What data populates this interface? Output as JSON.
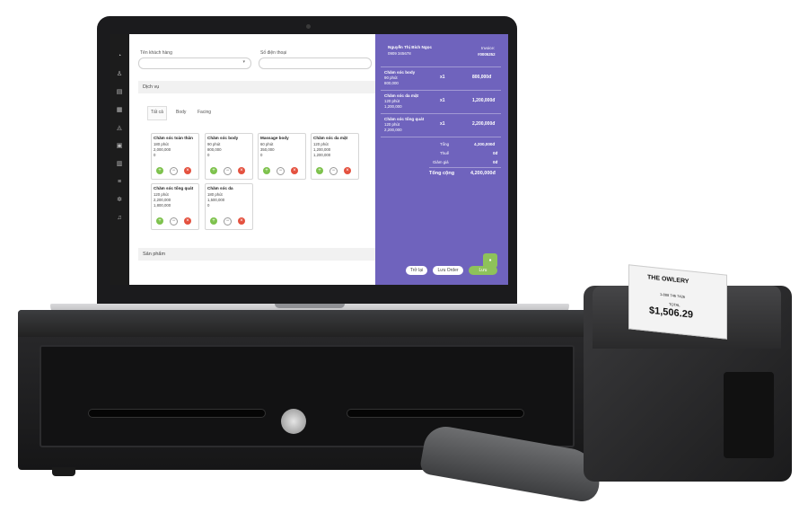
{
  "app": {
    "nav_icons": [
      "dashboard-icon",
      "users-icon",
      "calendar-icon",
      "grid-icon",
      "bag-icon",
      "gift-icon",
      "chart-icon",
      "list-icon",
      "gear-icon",
      "bell-icon"
    ],
    "customer_label": "Tên khách hàng",
    "phone_label": "Số điện thoại",
    "services_title": "Dịch vụ",
    "tabs": [
      "Tất cả",
      "Body",
      "Facing"
    ],
    "services": [
      {
        "name": "Chăm sóc toàn thân",
        "duration": "180 phút",
        "price": "2,000,000",
        "qty": "0"
      },
      {
        "name": "Chăm sóc body",
        "duration": "90 phút",
        "price": "800,000",
        "qty": "0"
      },
      {
        "name": "Massage body",
        "duration": "60 phút",
        "price": "350,000",
        "qty": "0"
      },
      {
        "name": "Chăm sóc da mặt",
        "duration": "120 phút",
        "price": "1,200,000",
        "qty": "1,200,000"
      },
      {
        "name": "Chăm sóc tổng quát",
        "duration": "120 phút",
        "price": "2,200,000",
        "qty": "1,800,000"
      },
      {
        "name": "Chăm sóc da",
        "duration": "180 phút",
        "price": "1,500,000",
        "qty": "0"
      }
    ],
    "products_title": "Sản phẩm"
  },
  "order": {
    "customer_name": "Nguyễn Thị Bích Ngọc",
    "customer_phone": "0909 345678",
    "invoice_label": "Invoice:",
    "invoice_no": "#0005252",
    "items": [
      {
        "name": "Chăm sóc body",
        "duration": "90 phút",
        "price": "800,000",
        "qty": "x1",
        "total": "800,000đ"
      },
      {
        "name": "Chăm sóc da mặt",
        "duration": "120 phút",
        "price": "1,200,000",
        "qty": "x1",
        "total": "1,200,000đ"
      },
      {
        "name": "Chăm sóc tổng quát",
        "duration": "120 phút",
        "price": "2,200,000",
        "qty": "x1",
        "total": "2,200,000đ"
      }
    ],
    "subtotal_label": "Tổng",
    "subtotal": "4,200,000đ",
    "tax_label": "Thuế",
    "tax": "0đ",
    "discount_label": "Giảm giá",
    "discount": "0đ",
    "grand_label": "Tổng cộng",
    "grand_total": "4,200,000đ",
    "back_button": "Trở lại",
    "save_button": "Lưu Order",
    "pay_button": "Lưu"
  },
  "receipt": {
    "store": "THE OWLERY",
    "phone": "1-888 746 7426",
    "total_label": "TOTAL",
    "total": "$1,506.29"
  },
  "colors": {
    "accent": "#6f63bd",
    "plus": "#7ec24d",
    "remove": "#e4513f"
  }
}
